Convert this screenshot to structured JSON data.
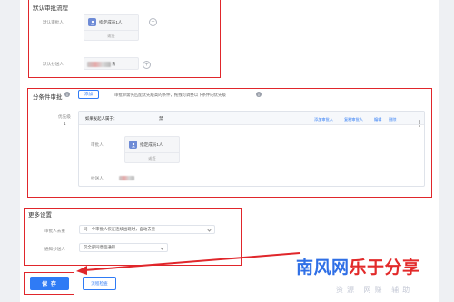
{
  "default_flow": {
    "title": "默认审批流程",
    "approver_label": "默认审批人",
    "approver_name": "指定成员1人",
    "approver_sub": "或签",
    "cc_label": "默认抄送人",
    "cc_suffix": "青"
  },
  "conditional": {
    "title": "分条件审批",
    "add_button": "添加",
    "hint": "审批单需先匹配优先级高的条件，拖拽可调整以下条件的优先级",
    "priority_label": "优先级",
    "priority_value": "1",
    "condition_text": "如果发起人属于：",
    "condition_suffix": "禁",
    "actions": [
      "添加审批人",
      "复制审批人",
      "编辑",
      "删除"
    ],
    "approver_label": "审批人",
    "approver_name": "指定成员1人",
    "approver_sub": "或签",
    "cc_label": "抄送人"
  },
  "more": {
    "title": "更多设置",
    "dedupe_label": "审批人去重",
    "dedupe_value": "同一个审批人仅在连续出现时，自动去重",
    "notify_label": "通知抄送人",
    "notify_value": "仅全部同意后通知"
  },
  "footer": {
    "save_label": "保 存",
    "preview_label": "流程检查"
  },
  "watermark": {
    "main_blue": "南风网",
    "main_red": "乐于分享",
    "sub": "资源 网赚 辅助"
  },
  "colors": {
    "accent": "#2f7bf5",
    "annotation_red": "#e0262b",
    "watermark_blue": "#2f6fe6",
    "watermark_red": "#e22a2a"
  },
  "icons": [
    "user-avatar-icon",
    "plus-circle-icon",
    "info-icon",
    "more-vertical-icon",
    "chevron-down-icon",
    "red-arrow-annotation"
  ]
}
